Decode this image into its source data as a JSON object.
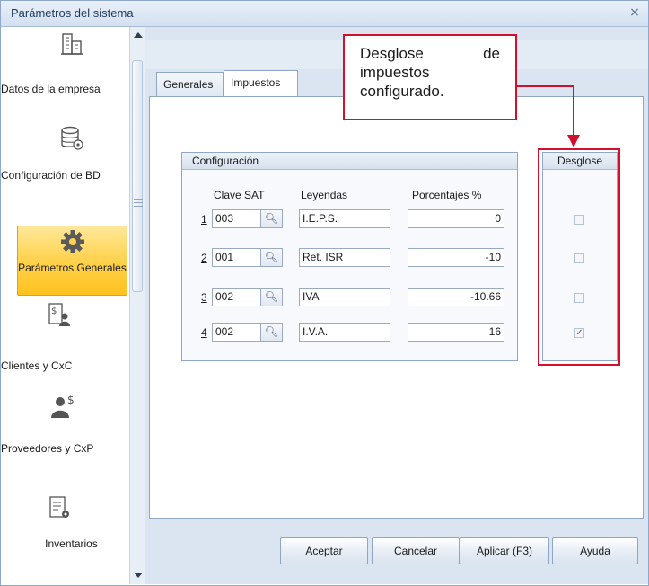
{
  "window": {
    "title": "Parámetros del sistema"
  },
  "sidebar": {
    "items": [
      {
        "label": "Datos de la empresa",
        "icon": "building-icon"
      },
      {
        "label": "Configuración de BD",
        "icon": "database-icon"
      },
      {
        "label": "Parámetros Generales",
        "icon": "gear-icon",
        "active": true
      },
      {
        "label": "Clientes y CxC",
        "icon": "clients-money-icon"
      },
      {
        "label": "Proveedores y CxP",
        "icon": "supplier-icon"
      },
      {
        "label": "Inventarios",
        "icon": "inventory-icon"
      }
    ]
  },
  "tabs": [
    {
      "label": "Generales"
    },
    {
      "label": "Impuestos",
      "active": true
    }
  ],
  "config": {
    "group_title": "Configuración",
    "col_clave": "Clave SAT",
    "col_leyendas": "Leyendas",
    "col_porcentajes": "Porcentajes %",
    "rows": [
      {
        "num": "1",
        "clave": "003",
        "leyenda": "I.E.P.S.",
        "porcentaje": "0",
        "desglose": false
      },
      {
        "num": "2",
        "clave": "001",
        "leyenda": "Ret. ISR",
        "porcentaje": "-10",
        "desglose": false
      },
      {
        "num": "3",
        "clave": "002",
        "leyenda": "IVA",
        "porcentaje": "-10.66",
        "desglose": false
      },
      {
        "num": "4",
        "clave": "002",
        "leyenda": "I.V.A.",
        "porcentaje": "16",
        "desglose": true
      }
    ]
  },
  "desglose": {
    "title": "Desglose"
  },
  "buttons": {
    "aceptar": "Aceptar",
    "cancelar": "Cancelar",
    "aplicar": "Aplicar (F3)",
    "ayuda": "Ayuda"
  },
  "callout": {
    "line1": "Desglose de",
    "line2": "impuestos",
    "line3": "configurado."
  },
  "colors": {
    "accent": "#d2102e",
    "active_item": "#ffd24d"
  }
}
